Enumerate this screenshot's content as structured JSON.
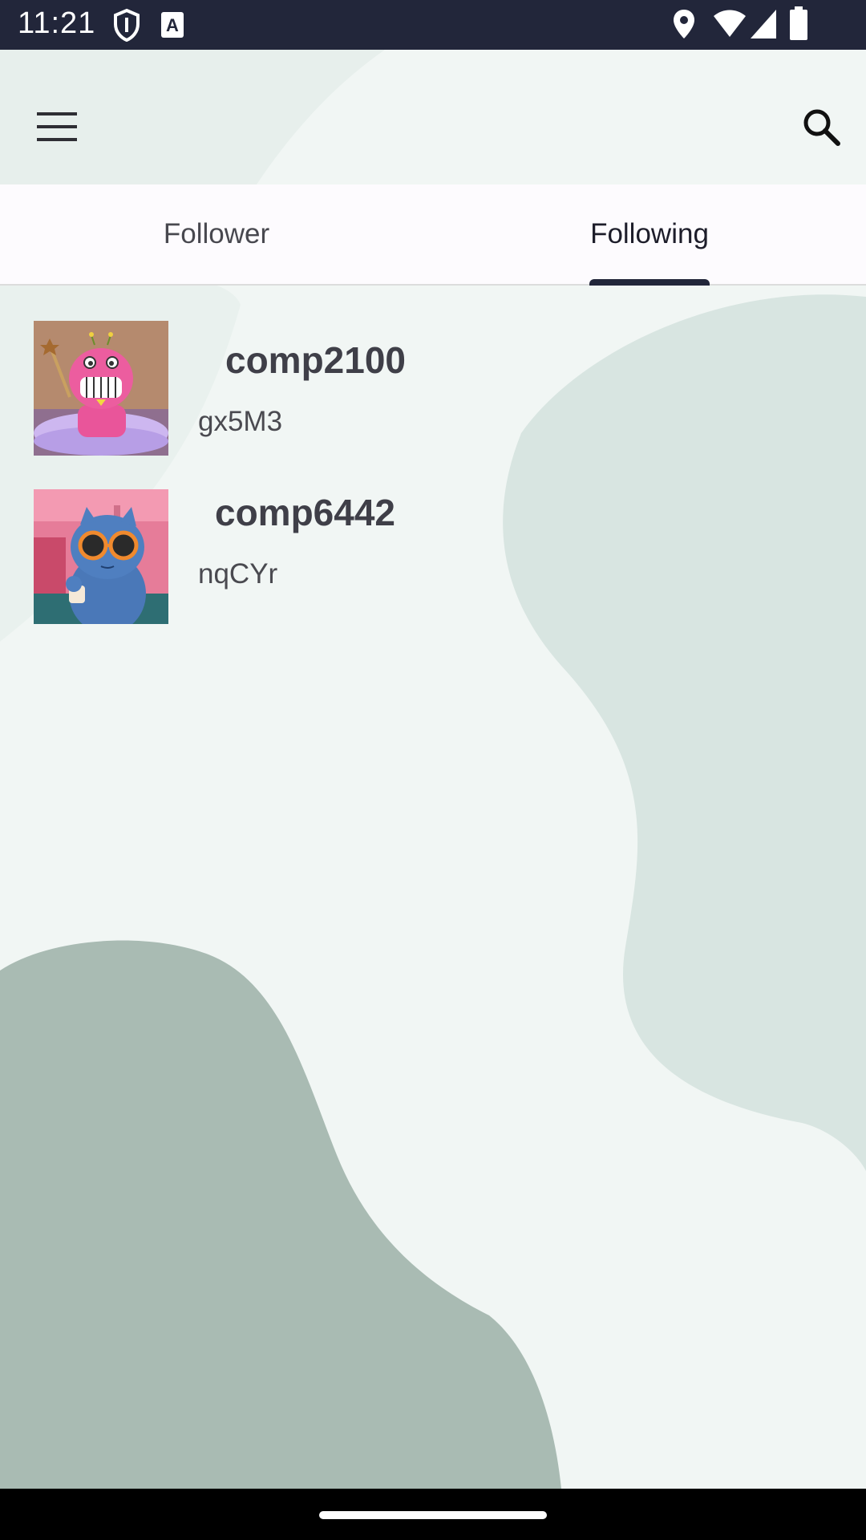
{
  "status_bar": {
    "time": "11:21",
    "icons": [
      "shield-icon",
      "text-a-icon",
      "location-icon",
      "wifi-icon",
      "signal-icon",
      "battery-icon"
    ]
  },
  "app_bar": {
    "menu_icon": "hamburger-menu-icon",
    "search_icon": "search-icon"
  },
  "tabs": [
    {
      "label": "Follower",
      "selected": false
    },
    {
      "label": "Following",
      "selected": true
    }
  ],
  "following": [
    {
      "name": "comp2100",
      "handle": "gx5M3",
      "avatar": "pink-cartoon-avatar"
    },
    {
      "name": "comp6442",
      "handle": "nqCYr",
      "avatar": "blue-cat-sunglasses-avatar"
    }
  ],
  "colors": {
    "status_bar": "#22263a",
    "background": "#f1f6f4",
    "blob_light": "#d8e5e1",
    "blob_dark": "#a9bbb3",
    "tab_indicator": "#22263a"
  }
}
